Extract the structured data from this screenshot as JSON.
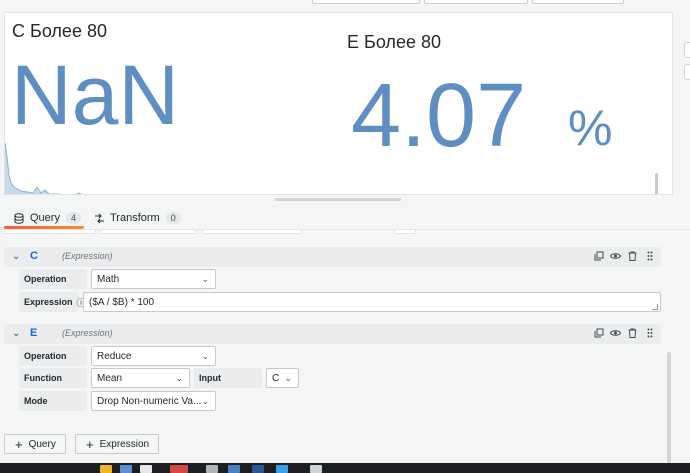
{
  "panel": {
    "stat_c": {
      "title": "C Более 80",
      "value": "NaN"
    },
    "stat_e": {
      "title": "E Более 80",
      "value": "4.07",
      "unit": "%"
    }
  },
  "tabs": [
    {
      "label": "Query",
      "count": "4",
      "icon": "database-icon",
      "active": true
    },
    {
      "label": "Transform",
      "count": "0",
      "icon": "transform-icon",
      "active": false
    }
  ],
  "queries": [
    {
      "name": "C",
      "type": "(Expression)",
      "operation_label": "Operation",
      "operation_value": "Math",
      "expression_label": "Expression",
      "expression_value": "($A / $B) * 100"
    },
    {
      "name": "E",
      "type": "(Expression)",
      "operation_label": "Operation",
      "operation_value": "Reduce",
      "function_label": "Function",
      "function_value": "Mean",
      "input_label": "Input",
      "input_value": "C",
      "mode_label": "Mode",
      "mode_value": "Drop Non-numeric Va..."
    }
  ],
  "buttons": {
    "add_query": "Query",
    "add_expression": "Expression"
  },
  "colors": {
    "stat_value": "#5f8fc2",
    "query_name": "#1f62e0",
    "tab_accent": "#f55f3e"
  }
}
